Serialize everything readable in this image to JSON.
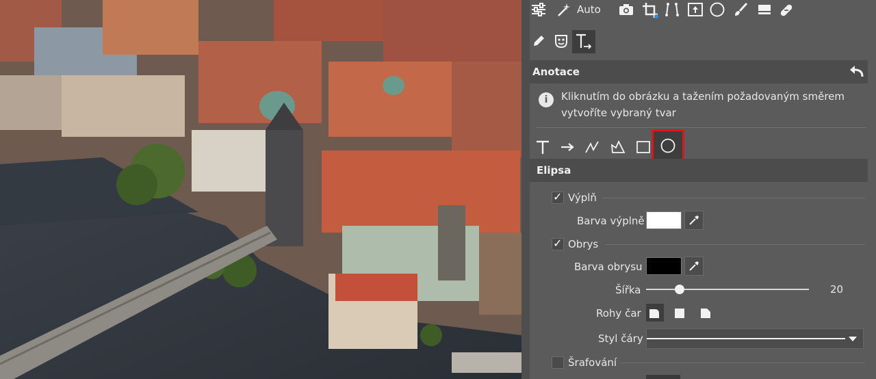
{
  "toolbar": {
    "row1": [
      {
        "name": "adjust-sliders-icon"
      },
      {
        "name": "magic-wand-icon",
        "label": "Auto"
      },
      {
        "name": "camera-icon"
      },
      {
        "name": "crop-icon"
      },
      {
        "name": "perspective-icon"
      },
      {
        "name": "frame-icon"
      },
      {
        "name": "circle-mask-icon"
      },
      {
        "name": "brush-icon"
      },
      {
        "name": "eraser-icon"
      },
      {
        "name": "bandage-icon"
      }
    ],
    "row2": [
      {
        "name": "pen-icon"
      },
      {
        "name": "mask-face-icon"
      },
      {
        "name": "text-annotation-icon",
        "active": true
      }
    ],
    "auto_label": "Auto"
  },
  "annotations": {
    "title": "Anotace",
    "info": "Kliknutím do obrázku a tažením požadovaným směrem vytvoříte vybraný tvar",
    "shape_tools": [
      "text-tool-icon",
      "arrow-tool-icon",
      "line-tool-icon",
      "polygon-tool-icon",
      "rectangle-tool-icon",
      "ellipse-tool-icon"
    ],
    "selected_tool": "ellipse-tool-icon",
    "highlight_color": "#e0141b"
  },
  "ellipse": {
    "title": "Elipsa",
    "fill": {
      "label": "Výplň",
      "checked": true,
      "color_label": "Barva výplně",
      "color": "#ffffff"
    },
    "outline": {
      "label": "Obrys",
      "checked": true,
      "color_label": "Barva obrysu",
      "color": "#000000"
    },
    "width": {
      "label": "Šířka",
      "value": "20",
      "fraction": 0.2
    },
    "corners": {
      "label": "Rohy čar",
      "options": [
        "rounded-corner-icon",
        "square-corner-icon",
        "bevel-corner-icon"
      ],
      "selected": 0
    },
    "line_style": {
      "label": "Styl čáry"
    },
    "hatching": {
      "label": "Šrafování",
      "checked": false
    }
  }
}
